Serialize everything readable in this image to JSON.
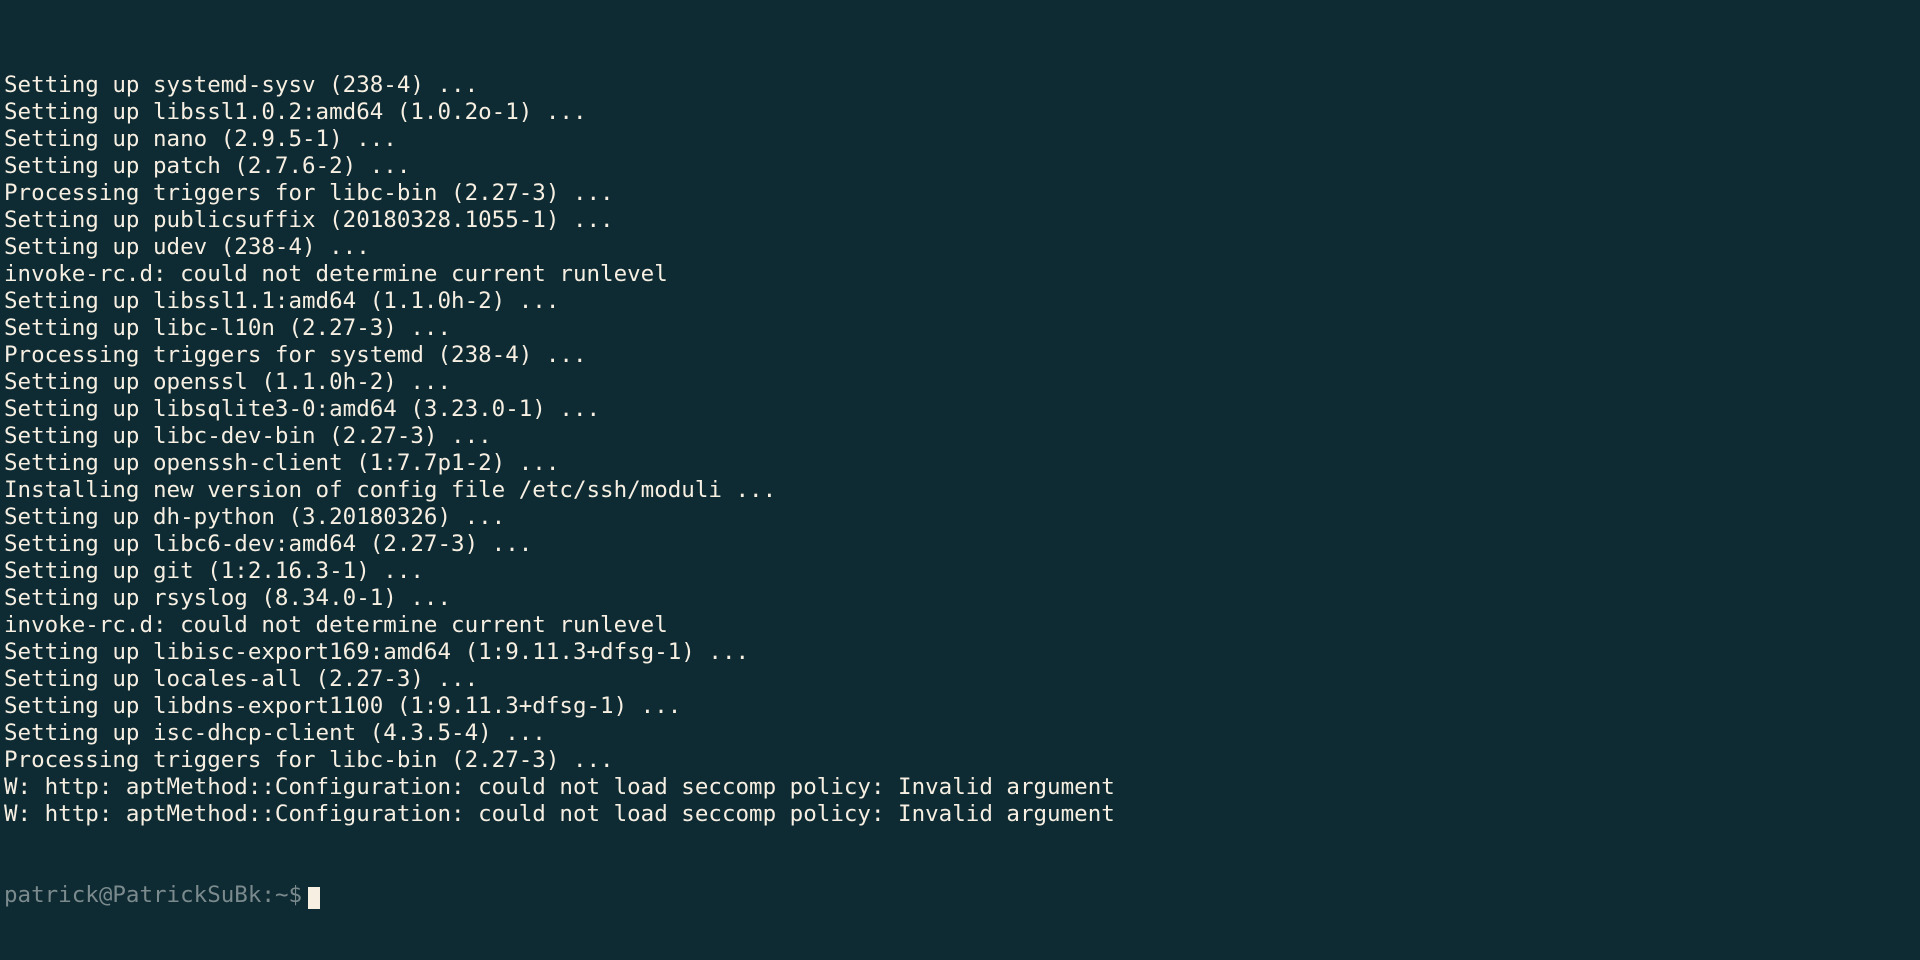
{
  "output_lines": [
    "Setting up systemd-sysv (238-4) ...",
    "Setting up libssl1.0.2:amd64 (1.0.2o-1) ...",
    "Setting up nano (2.9.5-1) ...",
    "Setting up patch (2.7.6-2) ...",
    "Processing triggers for libc-bin (2.27-3) ...",
    "Setting up publicsuffix (20180328.1055-1) ...",
    "Setting up udev (238-4) ...",
    "invoke-rc.d: could not determine current runlevel",
    "Setting up libssl1.1:amd64 (1.1.0h-2) ...",
    "Setting up libc-l10n (2.27-3) ...",
    "Processing triggers for systemd (238-4) ...",
    "Setting up openssl (1.1.0h-2) ...",
    "Setting up libsqlite3-0:amd64 (3.23.0-1) ...",
    "Setting up libc-dev-bin (2.27-3) ...",
    "Setting up openssh-client (1:7.7p1-2) ...",
    "Installing new version of config file /etc/ssh/moduli ...",
    "Setting up dh-python (3.20180326) ...",
    "Setting up libc6-dev:amd64 (2.27-3) ...",
    "Setting up git (1:2.16.3-1) ...",
    "Setting up rsyslog (8.34.0-1) ...",
    "invoke-rc.d: could not determine current runlevel",
    "Setting up libisc-export169:amd64 (1:9.11.3+dfsg-1) ...",
    "Setting up locales-all (2.27-3) ...",
    "Setting up libdns-export1100 (1:9.11.3+dfsg-1) ...",
    "Setting up isc-dhcp-client (4.3.5-4) ...",
    "Processing triggers for libc-bin (2.27-3) ...",
    "W: http: aptMethod::Configuration: could not load seccomp policy: Invalid argument",
    "W: http: aptMethod::Configuration: could not load seccomp policy: Invalid argument"
  ],
  "prompt": {
    "userhost": "patrick@PatrickSuBk",
    "colon": ":",
    "path": "~",
    "dollar": "$"
  }
}
